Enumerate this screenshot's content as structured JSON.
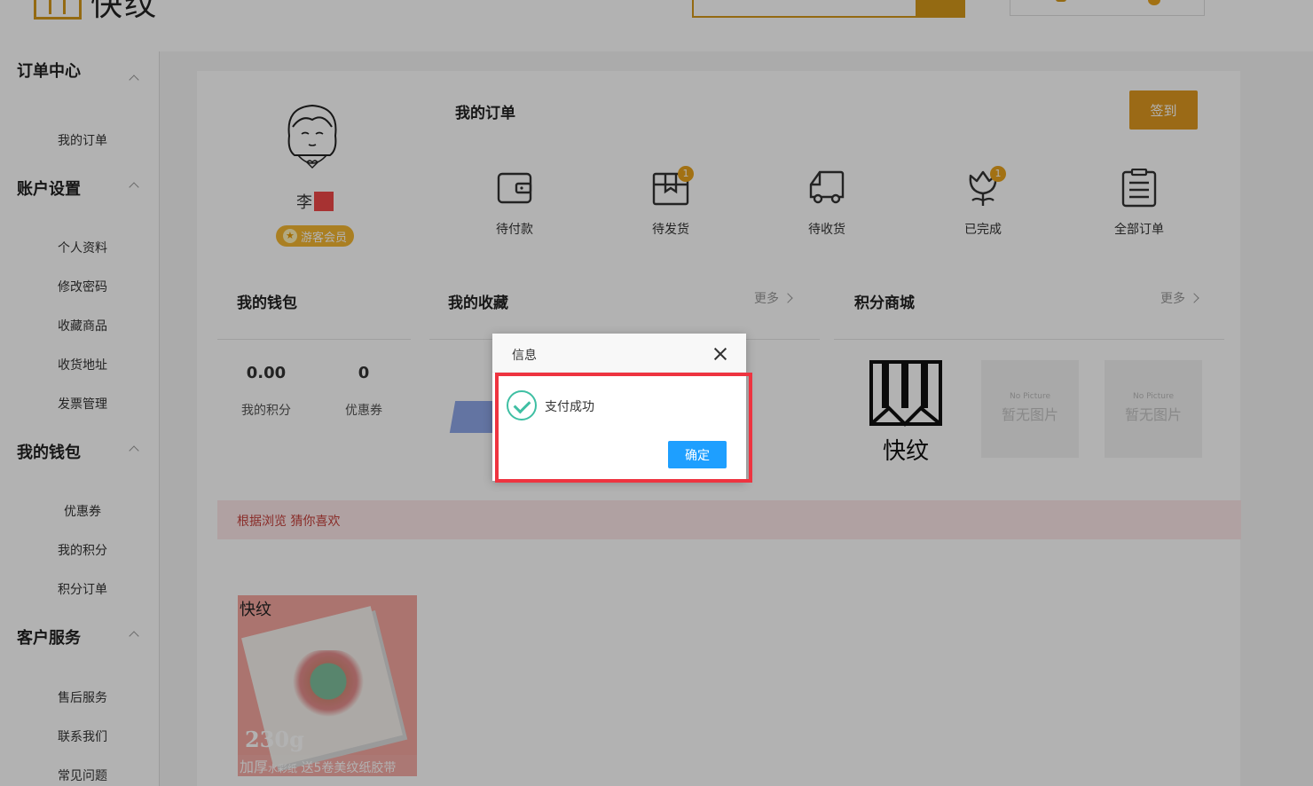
{
  "header": {
    "logo_text": "快纹",
    "search_placeholder": ""
  },
  "sidebar": {
    "sections": [
      {
        "title": "订单中心",
        "items": [
          "我的订单"
        ]
      },
      {
        "title": "账户设置",
        "items": [
          "个人资料",
          "修改密码",
          "收藏商品",
          "收货地址",
          "发票管理"
        ]
      },
      {
        "title": "我的钱包",
        "items": [
          "优惠券",
          "我的积分",
          "积分订单"
        ]
      },
      {
        "title": "客户服务",
        "items": [
          "售后服务",
          "联系我们",
          "常见问题"
        ]
      }
    ]
  },
  "profile": {
    "name": "李",
    "member_level": "游客会员",
    "member_star": "★"
  },
  "orders": {
    "title": "我的订单",
    "checkin_label": "签到",
    "statuses": [
      {
        "label": "待付款",
        "icon": "wallet-icon",
        "badge": ""
      },
      {
        "label": "待发货",
        "icon": "package-icon",
        "badge": "1"
      },
      {
        "label": "待收货",
        "icon": "truck-icon",
        "badge": ""
      },
      {
        "label": "已完成",
        "icon": "flower-icon",
        "badge": "1"
      },
      {
        "label": "全部订单",
        "icon": "clipboard-icon",
        "badge": ""
      }
    ]
  },
  "wallet": {
    "title": "我的钱包",
    "points_value": "0.00",
    "points_label": "我的积分",
    "coupons_value": "0",
    "coupons_label": "优惠券"
  },
  "favorites": {
    "title": "我的收藏",
    "more_label": "更多"
  },
  "points_mall": {
    "title": "积分商城",
    "more_label": "更多",
    "logo_text": "快纹",
    "placeholder_small": "No Picture",
    "placeholder_big": "暂无图片"
  },
  "recommend": {
    "title": "根据浏览 猜你喜欢",
    "product": {
      "brand": "快纹",
      "weight": "230g",
      "caption_bold": "加厚",
      "caption_small": "水彩纸",
      "caption_rest": " 送5卷美纹纸胶带"
    }
  },
  "dialog": {
    "title": "信息",
    "message": "支付成功",
    "ok_label": "确定"
  },
  "colors": {
    "accent": "#de9920",
    "ok_button": "#1e9fff",
    "highlight_frame": "#ee3440",
    "success": "#3fbfa3"
  }
}
